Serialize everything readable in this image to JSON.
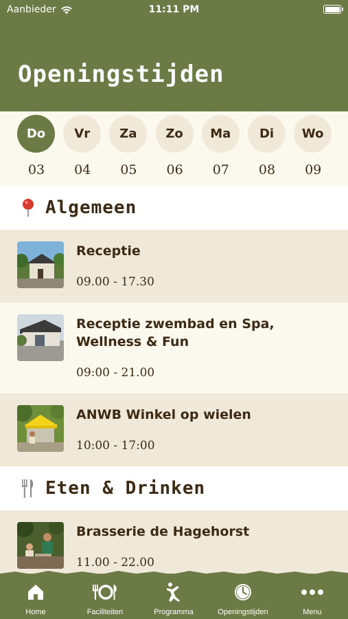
{
  "status": {
    "carrier": "Aanbieder",
    "time": "11:11 PM"
  },
  "header": {
    "title": "Openingstijden"
  },
  "days": [
    {
      "day": "Do",
      "num": "03",
      "active": true
    },
    {
      "day": "Vr",
      "num": "04",
      "active": false
    },
    {
      "day": "Za",
      "num": "05",
      "active": false
    },
    {
      "day": "Zo",
      "num": "06",
      "active": false
    },
    {
      "day": "Ma",
      "num": "07",
      "active": false
    },
    {
      "day": "Di",
      "num": "08",
      "active": false
    },
    {
      "day": "Wo",
      "num": "09",
      "active": false
    }
  ],
  "sections": {
    "general": {
      "label": "Algemeen",
      "icon": "pin-icon"
    },
    "food": {
      "label": "Eten & Drinken",
      "icon": "cutlery-icon"
    }
  },
  "items": [
    {
      "name": "Receptie",
      "hours": "09.00 - 17.30"
    },
    {
      "name": "Receptie zwembad en Spa, Wellness & Fun",
      "hours": "09:00 - 21.00"
    },
    {
      "name": "ANWB Winkel op wielen",
      "hours": "10:00 - 17:00"
    },
    {
      "name": "Brasserie de Hagehorst",
      "hours": "11.00 - 22.00"
    }
  ],
  "tabs": [
    {
      "label": "Home",
      "icon": "home-icon"
    },
    {
      "label": "Faciliteiten",
      "icon": "facilities-icon"
    },
    {
      "label": "Programma",
      "icon": "program-icon"
    },
    {
      "label": "Openingstijden",
      "icon": "clock-icon"
    },
    {
      "label": "Menu",
      "icon": "more-icon"
    }
  ],
  "colors": {
    "primary": "#6c7a45",
    "text": "#3d2a14",
    "cream": "#fbf8ee",
    "beige": "#f0e9d9"
  }
}
